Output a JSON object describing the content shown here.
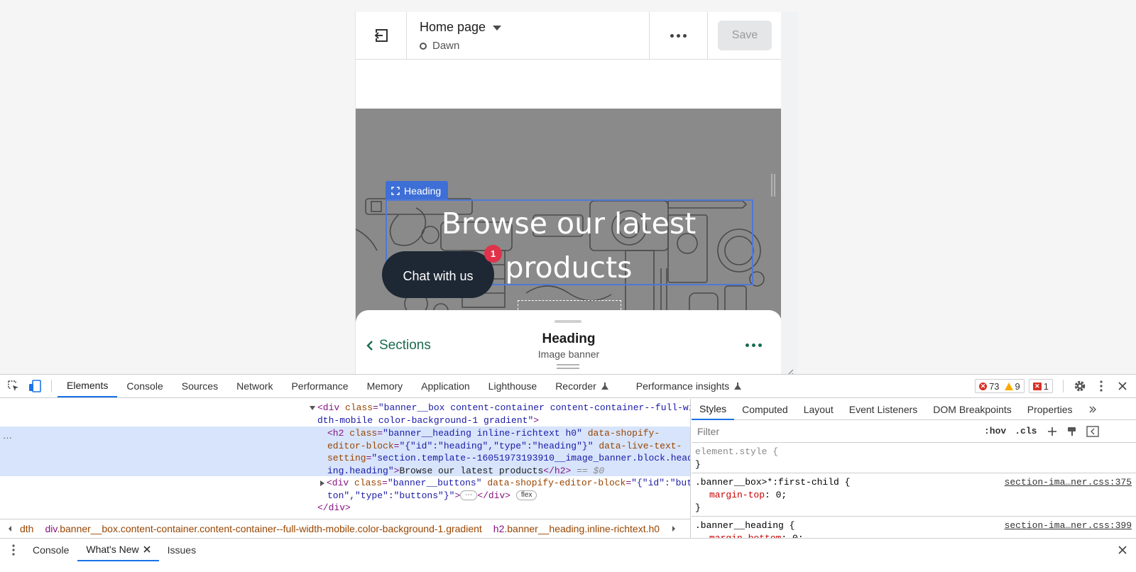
{
  "editor": {
    "page_title": "Home page",
    "theme_name": "Dawn",
    "save_label": "Save"
  },
  "preview": {
    "highlight_label": "Heading",
    "banner_heading": "Browse our latest products",
    "chat_button": "Chat with us",
    "chat_badge": "1"
  },
  "sheet": {
    "back_label": "Sections",
    "title": "Heading",
    "subtitle": "Image banner"
  },
  "devtools": {
    "tabs": [
      "Elements",
      "Console",
      "Sources",
      "Network",
      "Performance",
      "Memory",
      "Application",
      "Lighthouse",
      "Recorder",
      "Performance insights"
    ],
    "active_tab": "Elements",
    "errors": "73",
    "warnings": "9",
    "issues": "1",
    "dom": {
      "l1_class": "banner__box content-container content-container--full-wi",
      "l1b": "dth-mobile color-background-1 gradient",
      "h2_class": "banner__heading inline-richtext h0",
      "h2_block_a": "{\"id\":\"heading\",\"type\":\"heading\"}",
      "h2_live": "section.template--16051973193910__image_banner.block.head",
      "h2_live_b": "ing.heading",
      "h2_text": "Browse our latest products",
      "eq": "== $0",
      "buttons_class": "banner__buttons",
      "buttons_block_a": "{\"id\":\"but",
      "buttons_block_b": "ton\",\"type\":\"buttons\"}",
      "ellipsis": "⋯",
      "flex_pill": "flex"
    },
    "breadcrumbs": [
      {
        "text": "dth"
      },
      {
        "tag": "div",
        "cls": ".banner__box.content-container.content-container--full-width-mobile.color-background-1.gradient"
      },
      {
        "tag": "h2",
        "cls": ".banner__heading.inline-richtext.h0"
      }
    ],
    "styles_tabs": [
      "Styles",
      "Computed",
      "Layout",
      "Event Listeners",
      "DOM Breakpoints",
      "Properties"
    ],
    "filter_placeholder": "Filter",
    "hov": ":hov",
    "cls": ".cls",
    "rules": [
      {
        "selector": "element.style {",
        "src": "",
        "props": []
      },
      {
        "selector": ".banner__box>*:first-child {",
        "src": "section-ima…ner.css:375",
        "props": [
          {
            "name": "margin-top",
            "value": "0;"
          }
        ]
      },
      {
        "selector": ".banner__heading {",
        "src": "section-ima…ner.css:399",
        "props": [
          {
            "name": "margin-bottom",
            "value": "0;"
          }
        ]
      }
    ],
    "drawer_tabs": [
      "Console",
      "What's New",
      "Issues"
    ],
    "drawer_active": "What's New"
  }
}
